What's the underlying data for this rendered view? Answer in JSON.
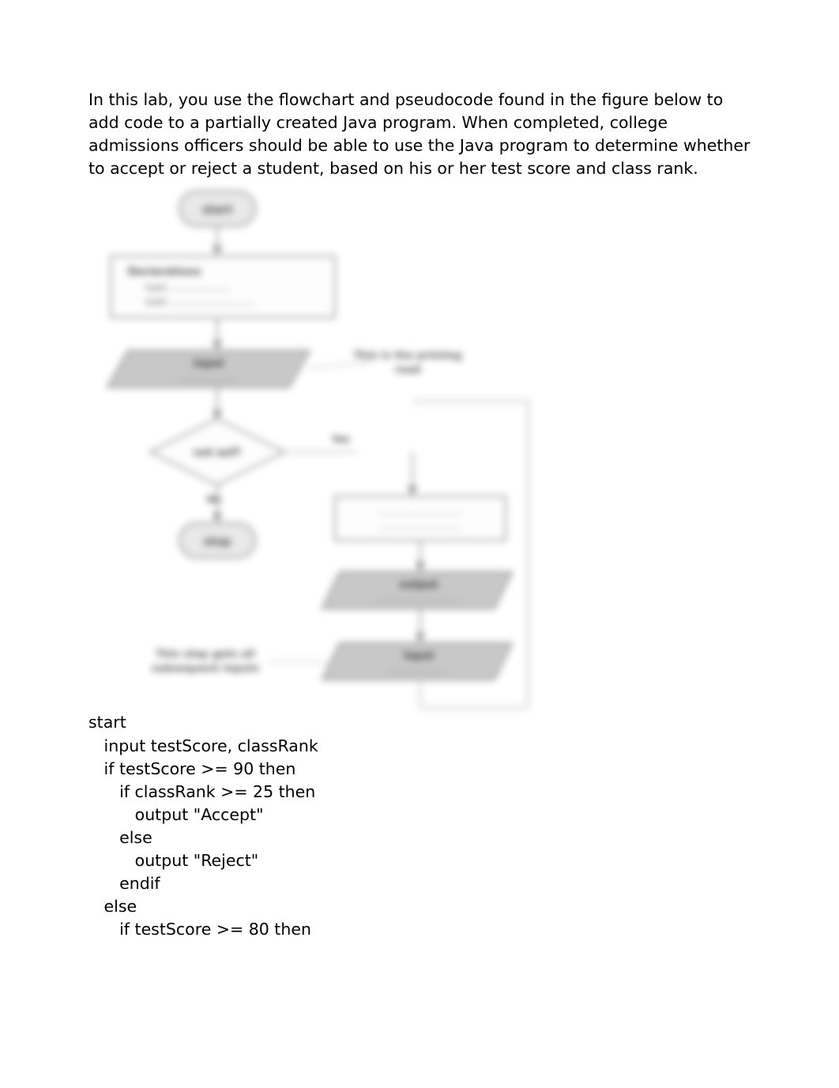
{
  "intro": "In this lab, you use the flowchart and pseudocode found in the figure below to add code to a partially created Java program. When completed, college admissions officers should be able to use the Java program to determine whether to accept or reject a student, based on his or her test score and class rank.",
  "flowchart": {
    "start_label": "start",
    "declarations_box": "Declarations\n   num   ___________\n   num   ___________",
    "input_box": "input\n___________",
    "priming_note": "This is the priming\nread",
    "decision": "not eof?",
    "decision_no": "No",
    "decision_yes": "Yes",
    "stop_label": "stop",
    "process_box": "___________________\n___________________",
    "output_box": "output\n___________________",
    "loop_note": "This step gets all\nsubsequent inputs",
    "loop_input_box": "input\n___________"
  },
  "pseudocode": {
    "line1": "start",
    "line2": "   input testScore, classRank",
    "line3": "   if testScore >= 90 then",
    "line4": "      if classRank >= 25 then",
    "line5": "         output \"Accept\"",
    "line6": "      else",
    "line7": "         output \"Reject\"",
    "line8": "      endif",
    "line9": "   else",
    "line10": "      if testScore >= 80 then"
  }
}
